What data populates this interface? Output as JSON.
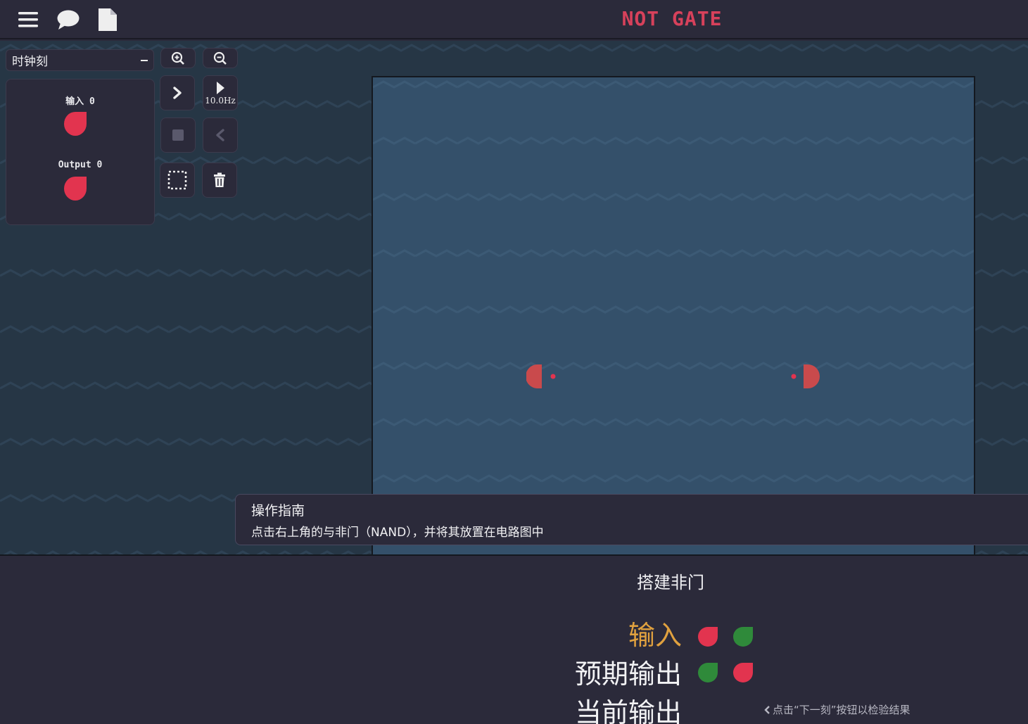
{
  "header": {
    "title": "NOT GATE",
    "icons": [
      "menu-icon",
      "chat-icon",
      "document-icon"
    ]
  },
  "toolbar": {
    "select_value": "时钟刻",
    "frequency": "10.0Hz",
    "buttons": [
      "zoom-in",
      "zoom-out",
      "step-forward",
      "play",
      "stop",
      "step-back",
      "select-area",
      "delete"
    ]
  },
  "io_panel": {
    "input_label": "输入 0",
    "output_label": "Output 0"
  },
  "guide": {
    "title": "操作指南",
    "text": "点击右上角的与非门（NAND），并将其放置在电路图中"
  },
  "level": {
    "name": "搭建非门",
    "rows": [
      {
        "label": "输入",
        "states": [
          "off",
          "on"
        ]
      },
      {
        "label": "预期输出",
        "states": [
          "on",
          "off"
        ]
      },
      {
        "label": "当前输出",
        "states": []
      }
    ],
    "hint": "点击“下一刻”按钮以检验结果"
  },
  "colors": {
    "off": "#e2344f",
    "on": "#2f8a3a",
    "accent": "#e0a13f",
    "title": "#d7415b"
  }
}
